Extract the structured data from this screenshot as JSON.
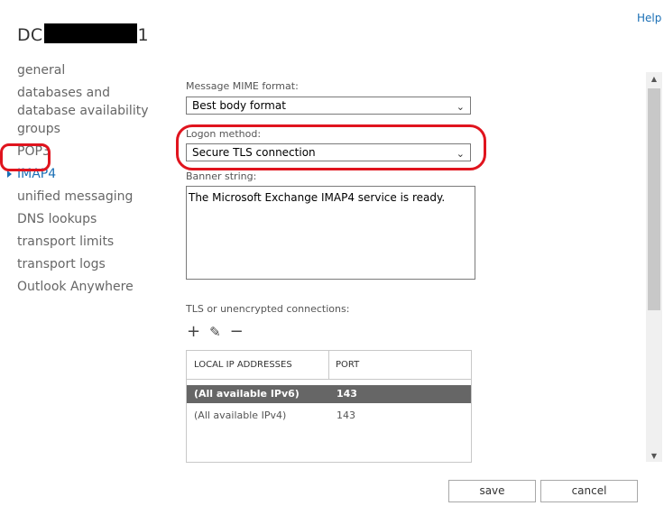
{
  "header": {
    "title_prefix": "DC",
    "title_suffix": "1",
    "help_label": "Help"
  },
  "nav": {
    "items": [
      {
        "label": "general"
      },
      {
        "label": "databases and database availability groups"
      },
      {
        "label": "POP3"
      },
      {
        "label": "IMAP4"
      },
      {
        "label": "unified messaging"
      },
      {
        "label": "DNS lookups"
      },
      {
        "label": "transport limits"
      },
      {
        "label": "transport logs"
      },
      {
        "label": "Outlook Anywhere"
      }
    ],
    "active_index": 3
  },
  "form": {
    "mime_label": "Message MIME format:",
    "mime_value": "Best body format",
    "logon_label": "Logon method:",
    "logon_value": "Secure TLS connection",
    "banner_label": "Banner string:",
    "banner_value": "The Microsoft Exchange IMAP4 service is ready.",
    "tls_label": "TLS or unencrypted connections:"
  },
  "toolbar": {
    "add_icon": "+",
    "edit_icon": "✎",
    "remove_icon": "−"
  },
  "table": {
    "columns": [
      "LOCAL IP ADDRESSES",
      "PORT"
    ],
    "rows": [
      {
        "address": "(All available IPv6)",
        "port": "143",
        "selected": true
      },
      {
        "address": "(All available IPv4)",
        "port": "143",
        "selected": false
      }
    ]
  },
  "buttons": {
    "save": "save",
    "cancel": "cancel"
  },
  "colors": {
    "accent": "#1a6fb5",
    "highlight_circle": "#e0141e",
    "selected_row": "#666666"
  }
}
